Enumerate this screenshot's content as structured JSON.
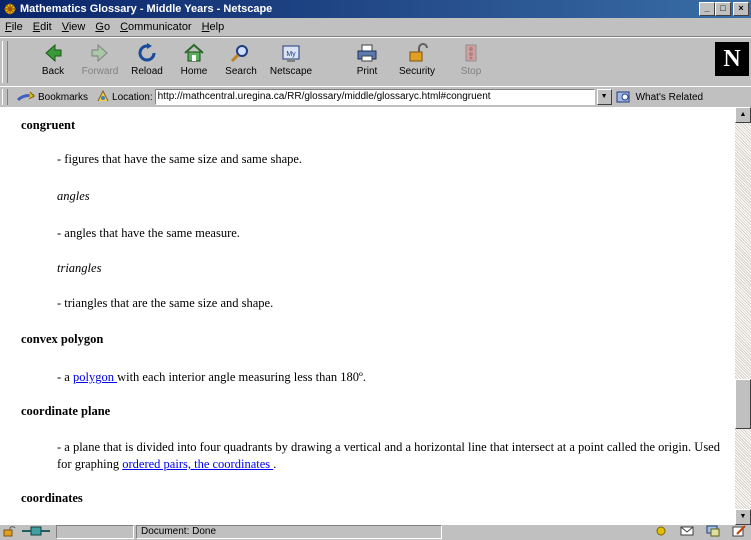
{
  "window": {
    "title": "Mathematics Glossary - Middle Years - Netscape",
    "controls": [
      "_",
      "□",
      "×"
    ]
  },
  "menu": [
    {
      "u": "F",
      "rest": "ile"
    },
    {
      "u": "E",
      "rest": "dit"
    },
    {
      "u": "V",
      "rest": "iew"
    },
    {
      "u": "G",
      "rest": "o"
    },
    {
      "u": "C",
      "rest": "ommunicator"
    },
    {
      "u": "H",
      "rest": "elp"
    }
  ],
  "toolbar": {
    "back": "Back",
    "forward": "Forward",
    "reload": "Reload",
    "home": "Home",
    "search": "Search",
    "netscape": "Netscape",
    "print": "Print",
    "security": "Security",
    "stop": "Stop",
    "logo": "N"
  },
  "location": {
    "bookmarks_label": "Bookmarks",
    "location_label": "Location:",
    "url": "http://mathcentral.uregina.ca/RR/glossary/middle/glossaryc.html#congruent",
    "related_label": "What's Related"
  },
  "content": {
    "congruent_term": "congruent",
    "congruent_def": "- figures that have the same size and same shape.",
    "angles_sub": "angles",
    "angles_def": "- angles that have the same measure.",
    "triangles_sub": "triangles",
    "triangles_def": "- triangles that are the same size and shape.",
    "convex_term": "convex polygon",
    "convex_pre": "- a ",
    "convex_link": "polygon ",
    "convex_post": "with each interior angle measuring less than 180º.",
    "coordplane_term": "coordinate plane",
    "coordplane_def": "- a plane that is divided into four quadrants by drawing a vertical and a horizontal line that intersect at a point called the origin. Used for graphing ",
    "coordplane_link": "ordered pairs, the coordinates ",
    "coordplane_post": ".",
    "coordinates_term": "coordinates"
  },
  "status": {
    "text": "Document: Done"
  }
}
